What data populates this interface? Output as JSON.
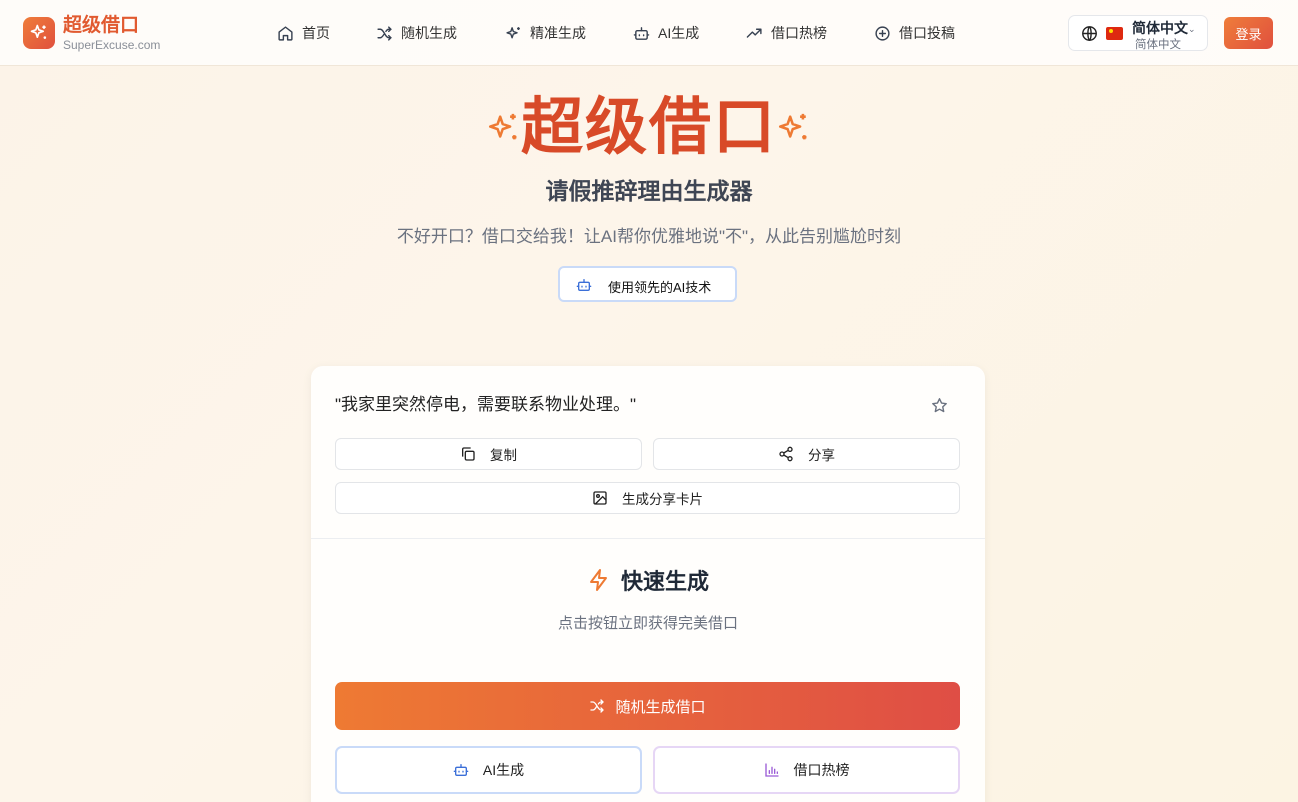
{
  "nav": {
    "logo_title": "超级借口",
    "logo_subtitle": "SuperExcuse.com",
    "items": [
      {
        "label": "首页",
        "icon": "home-icon"
      },
      {
        "label": "随机生成",
        "icon": "shuffle-icon"
      },
      {
        "label": "精准生成",
        "icon": "sparkles-icon"
      },
      {
        "label": "AI生成",
        "icon": "bot-icon"
      },
      {
        "label": "借口热榜",
        "icon": "trending-up-icon"
      },
      {
        "label": "借口投稿",
        "icon": "plus-circle-icon"
      }
    ],
    "language_main": "简体中文",
    "language_sub": "简体中文",
    "login_label": "登录"
  },
  "hero": {
    "title": "超级借口",
    "subtitle": "请假推辞理由生成器",
    "description": "不好开口？借口交给我！让AI帮你优雅地说\"不\"，从此告别尴尬时刻",
    "badge": "使用领先的AI技术"
  },
  "excuse_card": {
    "text": "\"我家里突然停电，需要联系物业处理。\"",
    "copy_label": "复制",
    "share_label": "分享",
    "share_card_label": "生成分享卡片"
  },
  "quick": {
    "title": "快速生成",
    "description": "点击按钮立即获得完美借口",
    "random_button": "随机生成借口",
    "ai_button": "AI生成",
    "ranking_button": "借口热榜"
  },
  "colors": {
    "brand": "#e15a30",
    "gradient_start": "#ee7a33",
    "gradient_end": "#df4e45"
  }
}
